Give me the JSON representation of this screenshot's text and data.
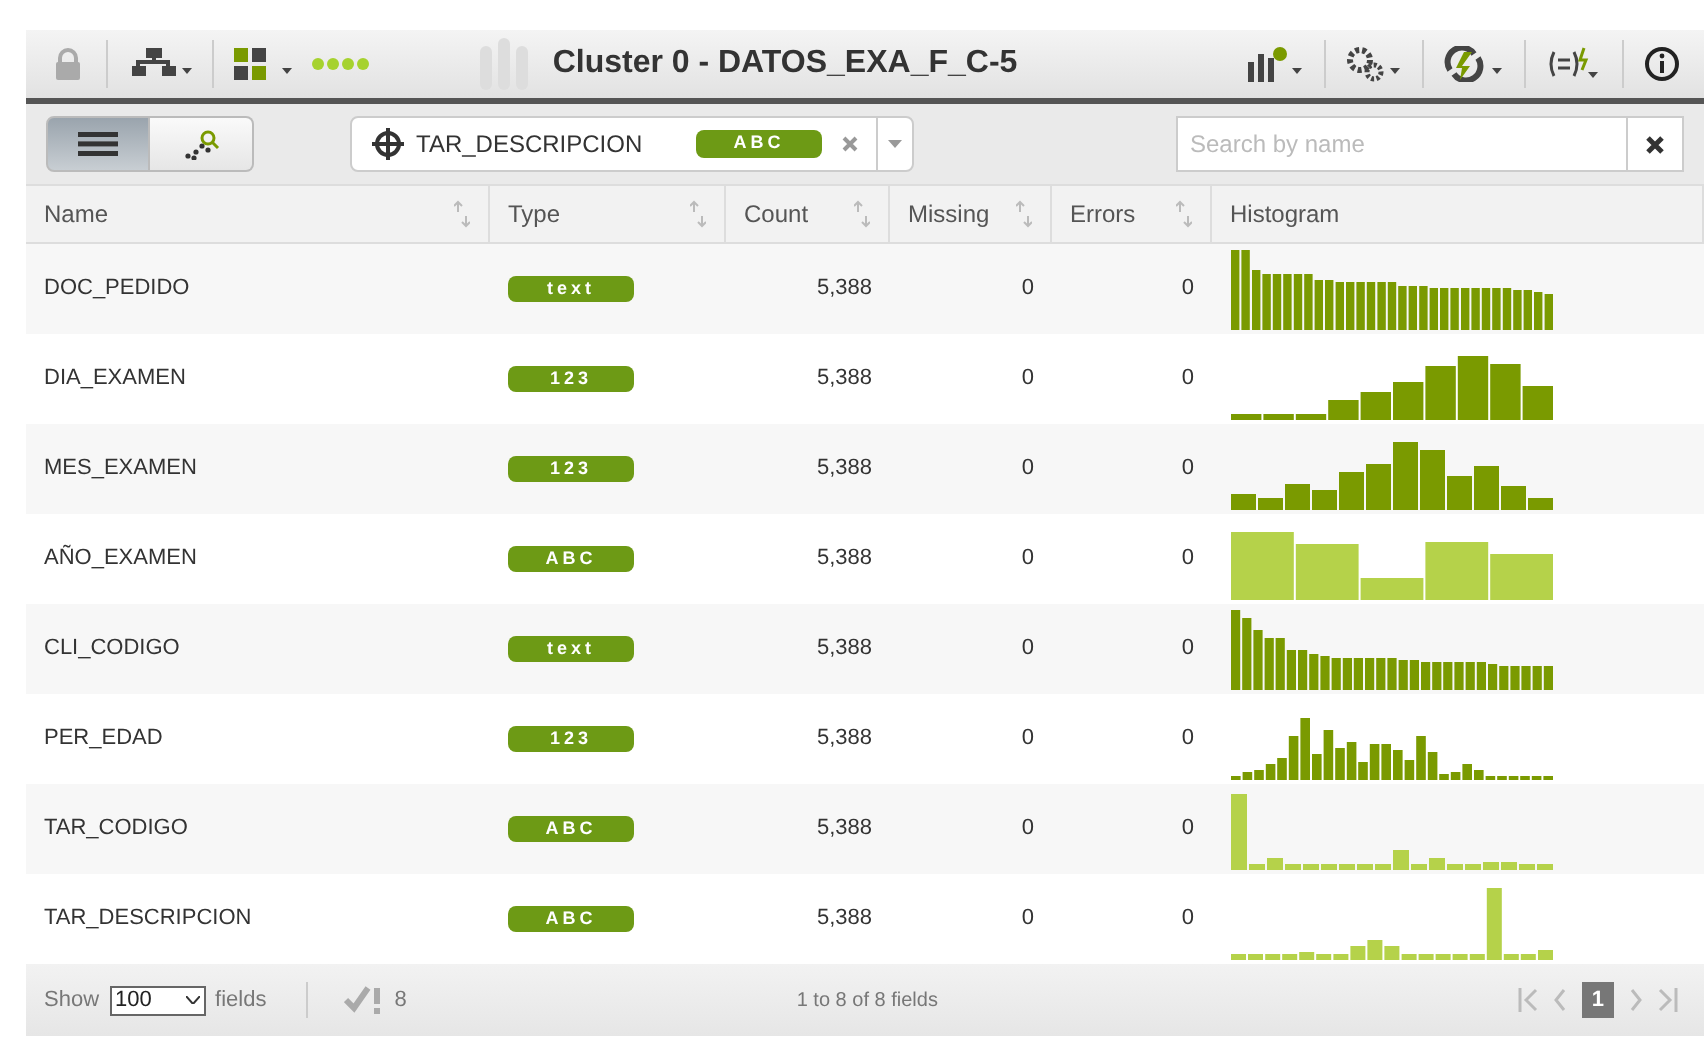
{
  "toolbar": {
    "title": "Cluster 0 - DATOS_EXA_F_C-5"
  },
  "filter": {
    "field": "TAR_DESCRIPCION",
    "type_badge": "ABC",
    "search_placeholder": "Search by name"
  },
  "view_toggle": [
    {
      "kind": "list",
      "selected": true
    },
    {
      "kind": "scatter",
      "selected": false
    }
  ],
  "table": {
    "columns": [
      "Name",
      "Type",
      "Count",
      "Missing",
      "Errors",
      "Histogram"
    ],
    "rows": [
      {
        "name": "DOC_PEDIDO",
        "type": "text",
        "kind": "text",
        "count": "5,388",
        "missing": "0",
        "errors": "0"
      },
      {
        "name": "DIA_EXAMEN",
        "type": "123",
        "kind": "numeric",
        "count": "5,388",
        "missing": "0",
        "errors": "0"
      },
      {
        "name": "MES_EXAMEN",
        "type": "123",
        "kind": "numeric",
        "count": "5,388",
        "missing": "0",
        "errors": "0"
      },
      {
        "name": "AÑO_EXAMEN",
        "type": "ABC",
        "kind": "categorical",
        "count": "5,388",
        "missing": "0",
        "errors": "0"
      },
      {
        "name": "CLI_CODIGO",
        "type": "text",
        "kind": "text",
        "count": "5,388",
        "missing": "0",
        "errors": "0"
      },
      {
        "name": "PER_EDAD",
        "type": "123",
        "kind": "numeric",
        "count": "5,388",
        "missing": "0",
        "errors": "0"
      },
      {
        "name": "TAR_CODIGO",
        "type": "ABC",
        "kind": "categorical",
        "count": "5,388",
        "missing": "0",
        "errors": "0"
      },
      {
        "name": "TAR_DESCRIPCION",
        "type": "ABC",
        "kind": "categorical",
        "count": "5,388",
        "missing": "0",
        "errors": "0"
      }
    ]
  },
  "footer": {
    "show_label": "Show",
    "page_size": "100",
    "fields_label": "fields",
    "count": "8",
    "range": "1 to 8 of 8 fields",
    "page": "1"
  }
}
